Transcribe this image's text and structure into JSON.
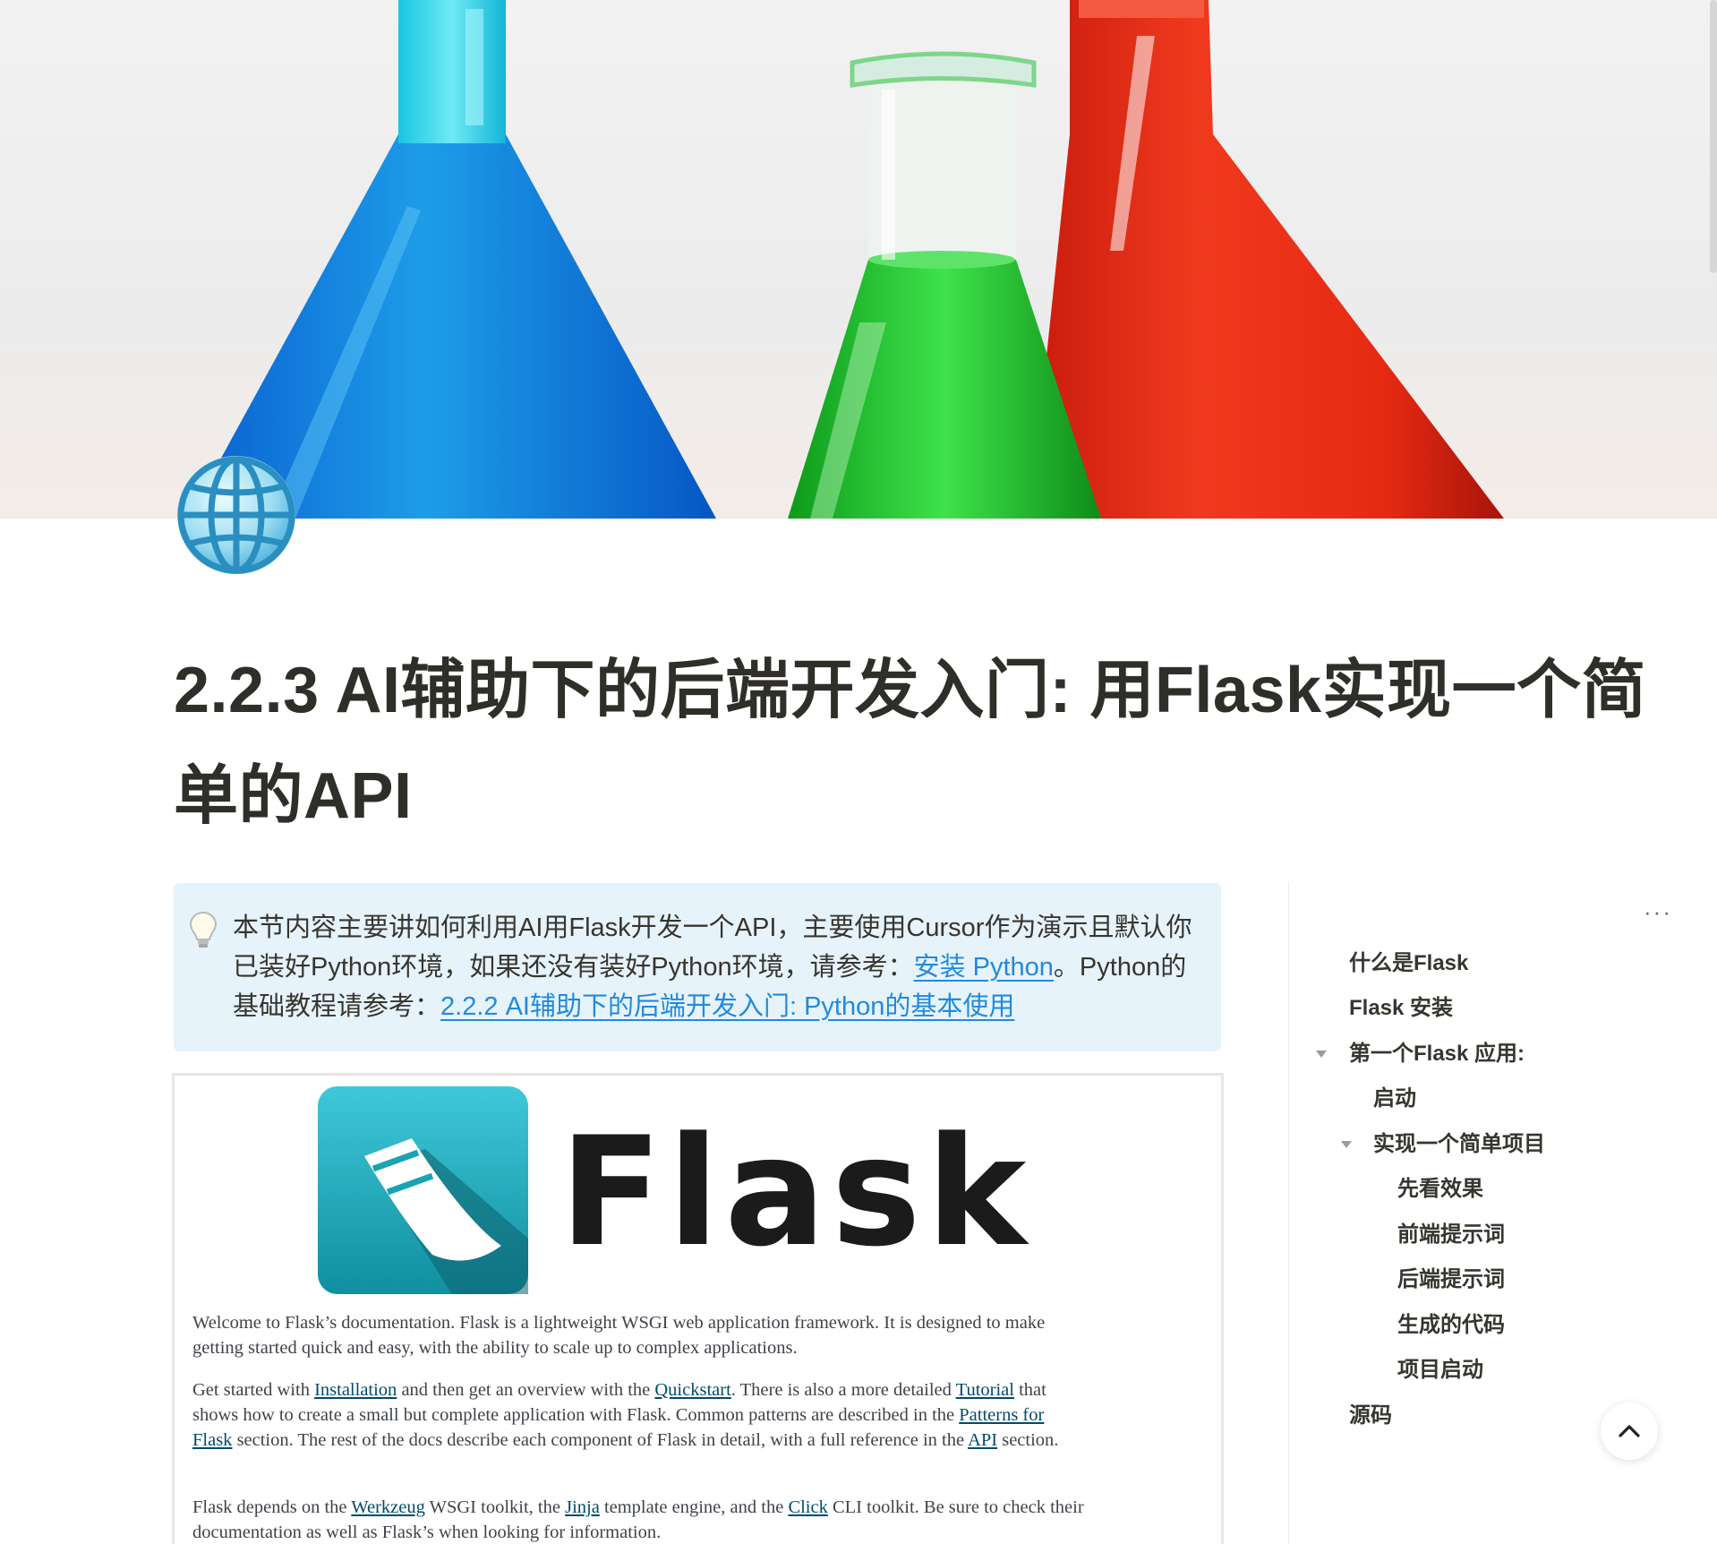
{
  "page": {
    "title": "2.2.3 AI辅助下的后端开发入门: 用Flask实现一个简单的API",
    "icon": "globe-icon",
    "cover": "lab-flasks-photo"
  },
  "callout": {
    "icon": "lightbulb-icon",
    "text_1": "本节内容主要讲如何利用AI用Flask开发一个API，主要使用Cursor作为演示且默认你已装好Python环境，如果还没有装好Python环境，请参考：",
    "link_1": "安装 Python",
    "text_2": "。Python的基础教程请参考：",
    "link_2": "2.2.2 AI辅助下的后端开发入门: Python的基本使用"
  },
  "embed": {
    "logo_text": "Flask",
    "p1": "Welcome to Flask’s documentation. Flask is a lightweight WSGI web application framework. It is designed to make getting started quick and easy, with the ability to scale up to complex applications.",
    "p2_a": "Get started with ",
    "p2_link1": "Installation",
    "p2_b": " and then get an overview with the ",
    "p2_link2": "Quickstart",
    "p2_c": ". There is also a more detailed ",
    "p2_link3": "Tutorial",
    "p2_d": " that shows how to create a small but complete application with Flask. Common patterns are described in the ",
    "p2_link4": "Patterns for Flask",
    "p2_e": " section. The rest of the docs describe each component of Flask in detail, with a full reference in the ",
    "p2_link5": "API",
    "p2_f": " section.",
    "p3_a": "Flask depends on the ",
    "p3_link1": "Werkzeug",
    "p3_b": " WSGI toolkit, the ",
    "p3_link2": "Jinja",
    "p3_c": " template engine, and the ",
    "p3_link3": "Click",
    "p3_d": " CLI toolkit. Be sure to check their documentation as well as Flask’s when looking for information."
  },
  "toc": {
    "menu": "···",
    "items": [
      {
        "label": "什么是Flask"
      },
      {
        "label": "Flask 安装"
      },
      {
        "label": "第一个Flask 应用:"
      },
      {
        "label": "启动"
      },
      {
        "label": "实现一个简单项目"
      },
      {
        "label": "先看效果"
      },
      {
        "label": "前端提示词"
      },
      {
        "label": "后端提示词"
      },
      {
        "label": "生成的代码"
      },
      {
        "label": "项目启动"
      },
      {
        "label": "源码"
      }
    ]
  },
  "controls": {
    "scroll_top": "chevron-up-icon"
  }
}
